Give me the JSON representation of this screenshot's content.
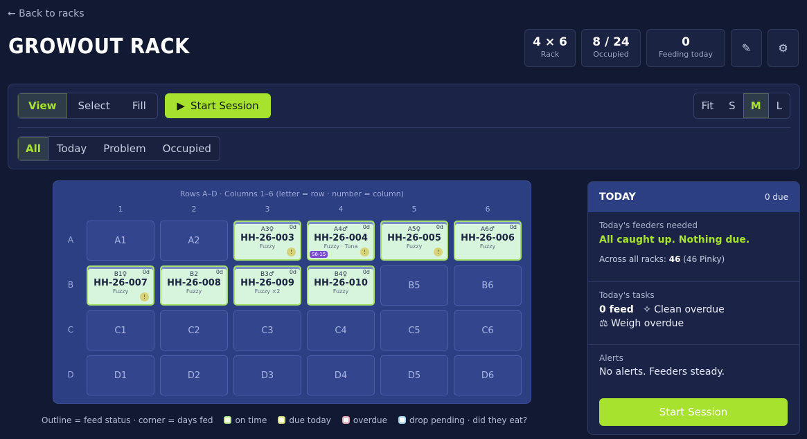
{
  "nav": {
    "back_label": "← Back to racks"
  },
  "page": {
    "title": "GROWOUT RACK"
  },
  "stats": [
    {
      "value": "4 × 6",
      "label": "Rack"
    },
    {
      "value": "8 / 24",
      "label": "Occupied"
    },
    {
      "value": "0",
      "label": "Feeding today"
    }
  ],
  "toolbar": {
    "modes": [
      "View",
      "Select",
      "Fill"
    ],
    "active_mode": "View",
    "start_session_label": "Start Session",
    "filters": [
      "All",
      "Today",
      "Problem",
      "Occupied"
    ],
    "active_filter": "All",
    "zoom_options": [
      "Fit",
      "S",
      "M",
      "L"
    ],
    "active_zoom": "M"
  },
  "rack": {
    "caption": "Rows A–D · Columns 1–6 (letter = row · number = column)",
    "columns": [
      "1",
      "2",
      "3",
      "4",
      "5",
      "6"
    ],
    "rows": [
      "A",
      "B",
      "C",
      "D"
    ],
    "cells": [
      {
        "pos": "A1",
        "occupied": false
      },
      {
        "pos": "A2",
        "occupied": false
      },
      {
        "pos": "A3",
        "occupied": true,
        "sex": "♀",
        "id": "HH-26-003",
        "food": "Fuzzy",
        "days": "0d",
        "flag": true
      },
      {
        "pos": "A4",
        "occupied": true,
        "sex": "♂",
        "id": "HH-26-004",
        "food": "Fuzzy · Tuna",
        "days": "0d",
        "flag": true,
        "tag": "S6-15"
      },
      {
        "pos": "A5",
        "occupied": true,
        "sex": "♀",
        "id": "HH-26-005",
        "food": "Fuzzy",
        "days": "0d",
        "flag": true
      },
      {
        "pos": "A6",
        "occupied": true,
        "sex": "♂",
        "id": "HH-26-006",
        "food": "Fuzzy",
        "days": "0d",
        "flag": false
      },
      {
        "pos": "B1",
        "occupied": true,
        "sex": "♀",
        "id": "HH-26-007",
        "food": "Fuzzy",
        "days": "0d",
        "flag": true
      },
      {
        "pos": "B2",
        "occupied": true,
        "sex": "",
        "id": "HH-26-008",
        "food": "Fuzzy",
        "days": "0d",
        "flag": false
      },
      {
        "pos": "B3",
        "occupied": true,
        "sex": "♂",
        "id": "HH-26-009",
        "food": "Fuzzy ×2",
        "days": "0d",
        "flag": false
      },
      {
        "pos": "B4",
        "occupied": true,
        "sex": "♀",
        "id": "HH-26-010",
        "food": "Fuzzy",
        "days": "0d",
        "flag": false
      },
      {
        "pos": "B5",
        "occupied": false
      },
      {
        "pos": "B6",
        "occupied": false
      },
      {
        "pos": "C1",
        "occupied": false
      },
      {
        "pos": "C2",
        "occupied": false
      },
      {
        "pos": "C3",
        "occupied": false
      },
      {
        "pos": "C4",
        "occupied": false
      },
      {
        "pos": "C5",
        "occupied": false
      },
      {
        "pos": "C6",
        "occupied": false
      },
      {
        "pos": "D1",
        "occupied": false
      },
      {
        "pos": "D2",
        "occupied": false
      },
      {
        "pos": "D3",
        "occupied": false
      },
      {
        "pos": "D4",
        "occupied": false
      },
      {
        "pos": "D5",
        "occupied": false
      },
      {
        "pos": "D6",
        "occupied": false
      }
    ]
  },
  "legend": {
    "intro": "Outline = feed status · corner = days fed",
    "items": [
      {
        "label": "on time",
        "color": "#b9e88a"
      },
      {
        "label": "due today",
        "color": "#d9e07a"
      },
      {
        "label": "overdue",
        "color": "#e6a0b0"
      },
      {
        "label": "drop pending · did they eat?",
        "color": "#a8d4f0"
      }
    ]
  },
  "today": {
    "title": "TODAY",
    "due": "0 due",
    "feeders_heading": "Today's feeders needed",
    "feeders_status": "All caught up. Nothing due.",
    "across_label": "Across all racks:",
    "across_value": "46",
    "across_detail": "(46 Pinky)",
    "tasks_heading": "Today's tasks",
    "tasks_feed": "0 feed",
    "tasks_clean": "Clean overdue",
    "tasks_weigh": "Weigh overdue",
    "alerts_heading": "Alerts",
    "alerts_text": "No alerts. Feeders steady.",
    "start_label": "Start Session"
  },
  "colors": {
    "accent": "#a6e22e",
    "background": "#121a33",
    "rack_bg": "#2d3f83",
    "cell_occupied": "#d7f5dc"
  }
}
